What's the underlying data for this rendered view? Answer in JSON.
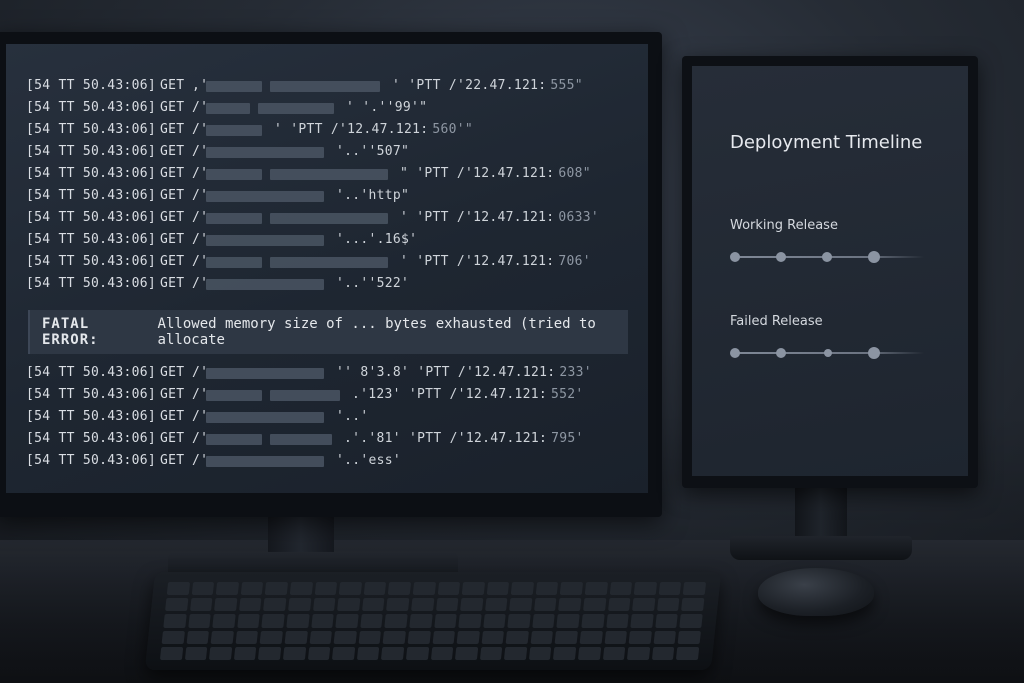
{
  "logs_top": [
    {
      "ts": "[54  TT 50.43:06]",
      "method": "GET",
      "q": ",'",
      "tail": "' 'PTT /'22.47.121:",
      "suffix": "555\""
    },
    {
      "ts": "[54  TT 50.43:06]",
      "method": "GET",
      "q": "/'",
      "tail": "' '.''99'\"",
      "suffix": ""
    },
    {
      "ts": "[54  TT 50.43:06]",
      "method": "GET",
      "q": "/'",
      "tail": "' 'PTT /'12.47.121:",
      "suffix": "560'\""
    },
    {
      "ts": "[54  TT 50.43:06]",
      "method": "GET",
      "q": "/'",
      "tail": "'..''507\"",
      "suffix": ""
    },
    {
      "ts": "[54  TT 50.43:06]",
      "method": "GET",
      "q": "/'",
      "tail": "\" 'PTT /'12.47.121:",
      "suffix": "608\""
    },
    {
      "ts": "[54  TT 50.43:06]",
      "method": "GET",
      "q": "/'",
      "tail": "'..'http\"",
      "suffix": ""
    },
    {
      "ts": "[54  TT 50.43:06]",
      "method": "GET",
      "q": "/'",
      "tail": "' 'PTT /'12.47.121:",
      "suffix": "0633'"
    },
    {
      "ts": "[54  TT 50.43:06]",
      "method": "GET",
      "q": "/'",
      "tail": "'...'.16$'",
      "suffix": ""
    },
    {
      "ts": "[54  TT 50.43:06]",
      "method": "GET",
      "q": "/'",
      "tail": "' 'PTT /'12.47.121:",
      "suffix": "706'"
    },
    {
      "ts": "[54  TT 50.43:06]",
      "method": "GET",
      "q": "/'",
      "tail": "'..''522'",
      "suffix": ""
    }
  ],
  "fatal": {
    "label": "FATAL ERROR:",
    "message": "Allowed memory size of ... bytes exhausted (tried to allocate"
  },
  "logs_bottom": [
    {
      "ts": "[54  TT 50.43:06]",
      "method": "GET",
      "q": "/'",
      "tail": "'' 8'3.8' 'PTT /'12.47.121:",
      "suffix": "233'"
    },
    {
      "ts": "[54  TT 50.43:06]",
      "method": "GET",
      "q": "/'",
      "tail": ".'123' 'PTT /'12.47.121:",
      "suffix": "552'"
    },
    {
      "ts": "[54  TT 50.43:06]",
      "method": "GET",
      "q": "/'",
      "tail": "'..'",
      "suffix": ""
    },
    {
      "ts": "[54  TT 50.43:06]",
      "method": "GET",
      "q": "/'",
      "tail": ".'.'81' 'PTT /'12.47.121:",
      "suffix": "795'"
    },
    {
      "ts": "[54  TT 50.43:06]",
      "method": "GET",
      "q": "/'",
      "tail": "'..'ess'",
      "suffix": ""
    }
  ],
  "timeline": {
    "title": "Deployment Timeline",
    "working_label": "Working Release",
    "failed_label": "Failed Release"
  }
}
